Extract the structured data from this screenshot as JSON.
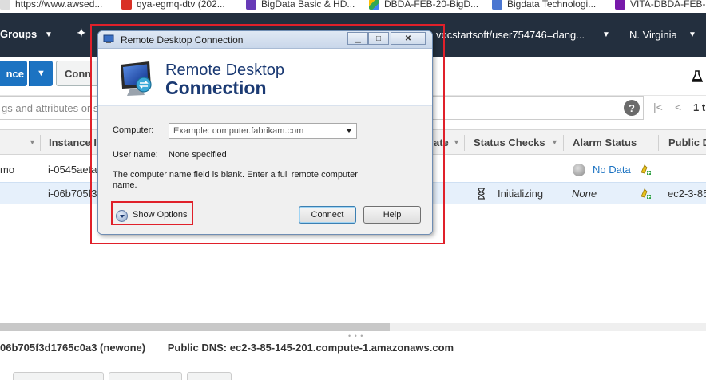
{
  "bookmarks": [
    {
      "label": "https://www.awsed..."
    },
    {
      "label": "qya-egmq-dtv (202..."
    },
    {
      "label": "BigData Basic & HD..."
    },
    {
      "label": "DBDA-FEB-20-BigD..."
    },
    {
      "label": "Bigdata Technologi..."
    },
    {
      "label": "VITA-DBDA-FEB-..."
    }
  ],
  "nav": {
    "groups_label": "Groups",
    "account_label": "vocstartsoft/user754746=dang...",
    "region_label": "N. Virginia"
  },
  "toolbar": {
    "launch_label": "nce",
    "connect_label": "Conn"
  },
  "filter": {
    "placeholder": "gs and attributes or s",
    "page_count": "1 t"
  },
  "table": {
    "headers": {
      "instance_id": "Instance I",
      "state": "ate",
      "status_checks": "Status Checks",
      "alarm_status": "Alarm Status",
      "public_dns": "Public D"
    },
    "rows": [
      {
        "name": "mo",
        "instance_id": "i-0545aeta",
        "status": "",
        "alarm": "No Data",
        "dns": ""
      },
      {
        "name": "",
        "instance_id": "i-06b705f3",
        "status": "Initializing",
        "alarm": "None",
        "dns": "ec2-3-85"
      }
    ]
  },
  "details": {
    "instance": "06b705f3d1765c0a3 (newone)",
    "dns_label": "Public DNS:",
    "dns_value": "ec2-3-85-145-201.compute-1.amazonaws.com"
  },
  "dialog": {
    "title": "Remote Desktop Connection",
    "banner_line1": "Remote Desktop",
    "banner_line2": "Connection",
    "computer_label": "Computer:",
    "computer_placeholder": "Example: computer.fabrikam.com",
    "username_label": "User name:",
    "username_value": "None specified",
    "message": "The computer name field is blank. Enter a full remote computer name.",
    "show_options_label": "Show Options",
    "connect_label": "Connect",
    "help_label": "Help"
  },
  "colors": {
    "aws_nav": "#232f3e",
    "aws_blue": "#1c73c2",
    "annotation_red": "#e0202a",
    "dialog_title": "#1b3a73"
  }
}
